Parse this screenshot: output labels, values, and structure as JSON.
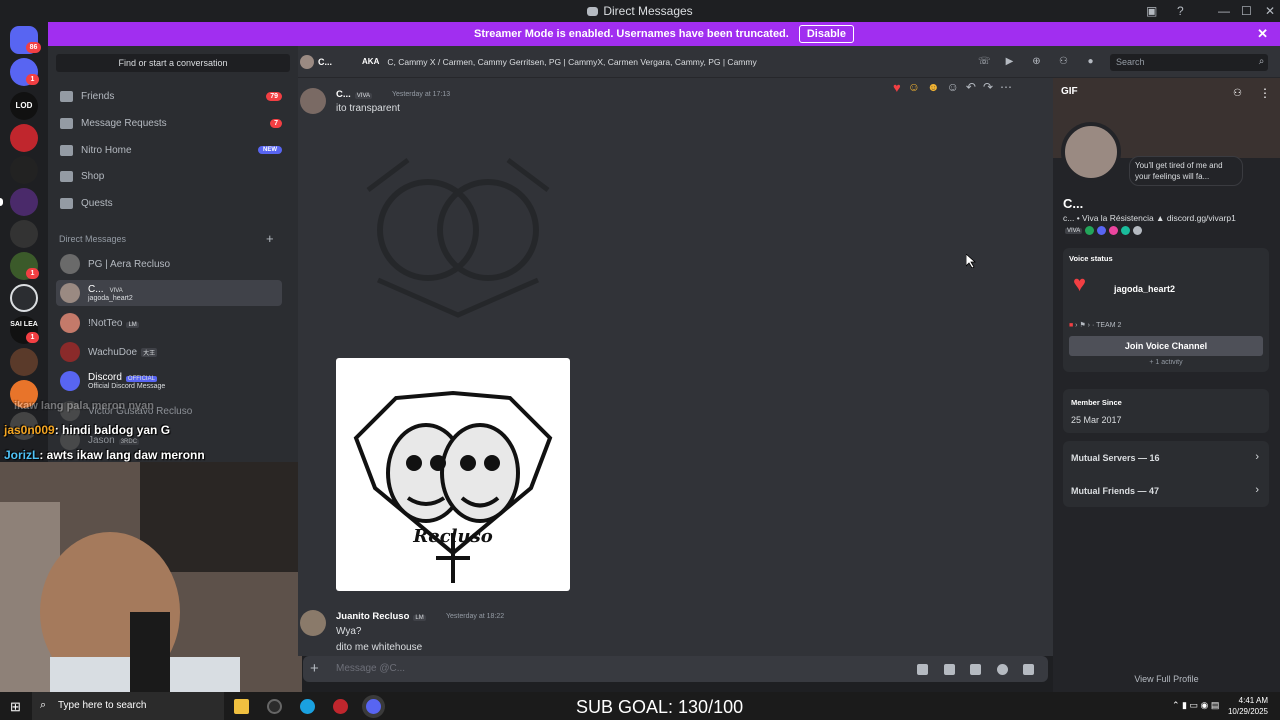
{
  "window": {
    "title": "Direct Messages"
  },
  "banner": {
    "text": "Streamer Mode is enabled. Usernames have been truncated.",
    "button": "Disable"
  },
  "rail": {
    "badge_top": "86",
    "badges": [
      "1",
      "1",
      "1"
    ],
    "labels": [
      "LOD",
      "SAI LEA"
    ]
  },
  "sidebar": {
    "search": "Find or start a conversation",
    "nav": [
      {
        "label": "Friends",
        "count": "79"
      },
      {
        "label": "Message Requests",
        "count": "7"
      },
      {
        "label": "Nitro Home",
        "tag": "NEW"
      },
      {
        "label": "Shop"
      },
      {
        "label": "Quests"
      }
    ],
    "dm_header": "Direct Messages",
    "dms": [
      {
        "name": "PG | Aera Recluso"
      },
      {
        "name": "C...",
        "tag": "VIVA",
        "sub": "jagoda_heart2"
      },
      {
        "name": "!NotTeo",
        "tag": "LM"
      },
      {
        "name": "WachuDoe",
        "tag": "大王"
      },
      {
        "name": "Discord",
        "tag": "OFFICIAL",
        "sub": "Official Discord Message"
      },
      {
        "name": "Victor Gustavo Recluso"
      },
      {
        "name": "Jason",
        "tag": "3RDC"
      }
    ]
  },
  "chat_overlay": [
    {
      "user": "jas0n009",
      "text": ": hindi baldog yan G"
    },
    {
      "user": "JorizL",
      "text": ": awts ikaw lang daw meronn"
    },
    {
      "faint": "ikaw lang pala meron nyan"
    }
  ],
  "header": {
    "name": "C...",
    "aka_label": "AKA",
    "aka_names": "C, Cammy X / Carmen, Cammy Gerritsen, PG | CammyX, Carmen Vergara, Cammy, PG | Cammy",
    "search_placeholder": "Search"
  },
  "messages": [
    {
      "author": "C...",
      "tag": "VIVA",
      "time": "Yesterday at 17:13",
      "text": "ito transparent"
    },
    {
      "author": "Juanito Recluso",
      "tag": "LM",
      "time": "Yesterday at 18:22",
      "lines": [
        "Wya?",
        "dito me whitehouse"
      ]
    }
  ],
  "image": {
    "caption": "Recluso"
  },
  "composer": {
    "placeholder": "Message @C..."
  },
  "profile": {
    "gif_label": "GIF",
    "bubble": "You'll get tired of me and your feelings will fa...",
    "name": "C...",
    "bio": "c... • Viva la Résistencia ▲ discord.gg/vivarp1",
    "badge_tag": "VIVA",
    "voice_title": "Voice status",
    "voice_user": "jagoda_heart2",
    "voice_team": "TEAM 2",
    "join_button": "Join Voice Channel",
    "activity": "+ 1 activity",
    "member_since_label": "Member Since",
    "member_since": "25 Mar 2017",
    "mutual_servers": "Mutual Servers — 16",
    "mutual_friends": "Mutual Friends — 47",
    "view_full": "View Full Profile"
  },
  "taskbar": {
    "search": "Type here to search",
    "sub_goal": "SUB GOAL: 130/100",
    "time": "4:41 AM",
    "date": "10/29/2025"
  },
  "colors": {
    "accent": "#5865f2",
    "banner": "#a12ef0",
    "danger": "#f23f43"
  }
}
